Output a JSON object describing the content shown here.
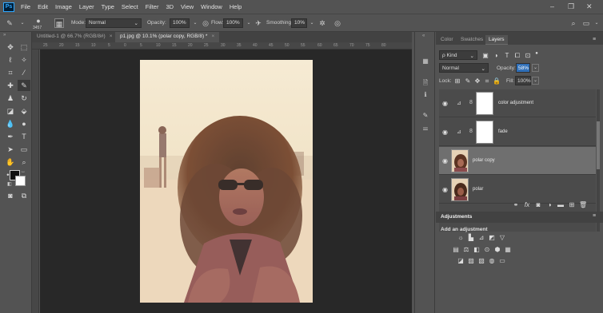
{
  "menu": {
    "logo": "Ps",
    "items": [
      "File",
      "Edit",
      "Image",
      "Layer",
      "Type",
      "Select",
      "Filter",
      "3D",
      "View",
      "Window",
      "Help"
    ]
  },
  "options": {
    "brush_size": "3457",
    "mode_label": "Mode:",
    "mode_value": "Normal",
    "opacity_label": "Opacity:",
    "opacity_value": "100%",
    "flow_label": "Flow:",
    "flow_value": "100%",
    "smoothing_label": "Smoothing:",
    "smoothing_value": "10%"
  },
  "tabs": [
    {
      "label": "Untitled-1 @ 66.7% (RGB/8#)",
      "close": "×"
    },
    {
      "label": "p1.jpg @ 10.1% (polar copy, RGB/8) *",
      "close": "×"
    }
  ],
  "ruler_ticks": [
    "25",
    "20",
    "15",
    "10",
    "5",
    "0",
    "5",
    "10",
    "15",
    "20",
    "25",
    "30",
    "35",
    "40",
    "45",
    "50",
    "55",
    "60",
    "65",
    "70",
    "75",
    "80"
  ],
  "panel": {
    "tabs": [
      "Color",
      "Swatches",
      "Layers"
    ],
    "kind_label": "ρ Kind",
    "blend_mode": "Normal",
    "opacity_label": "Opacity:",
    "opacity_value": "58%",
    "lock_label": "Lock:",
    "fill_label": "Fill:",
    "fill_value": "100%",
    "layers": [
      {
        "name": "color adjustment",
        "type": "adjustment"
      },
      {
        "name": "fade",
        "type": "adjustment"
      },
      {
        "name": "polar copy",
        "type": "image",
        "selected": true
      },
      {
        "name": "polar",
        "type": "image"
      }
    ],
    "adjustments_title": "Adjustments",
    "add_adjustment_label": "Add an adjustment"
  }
}
